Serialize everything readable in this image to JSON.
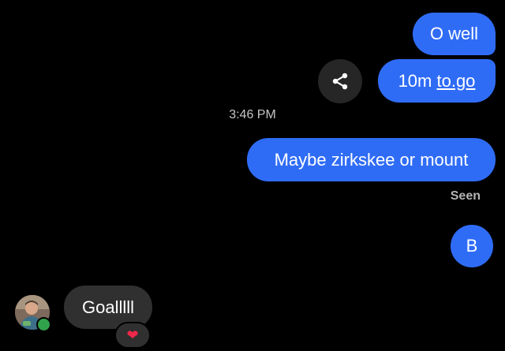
{
  "messages": {
    "outgoing_1": "O well",
    "outgoing_2_prefix": "10m ",
    "outgoing_2_link": "to.go",
    "outgoing_3": "Maybe zirkskee or mount",
    "outgoing_4": "B",
    "incoming_1": "Goalllll"
  },
  "timestamp": "3:46 PM",
  "receipt": "Seen",
  "reaction": {
    "emoji": "❤",
    "icon": "heart-reaction-icon",
    "color": "#f02849"
  },
  "icons": {
    "share": "share-icon",
    "avatar": "contact-avatar",
    "presence": "online-status-dot"
  },
  "colors": {
    "background": "#000000",
    "outgoing_bubble": "#2f6cf6",
    "incoming_bubble": "#303030",
    "online": "#31a24c"
  }
}
